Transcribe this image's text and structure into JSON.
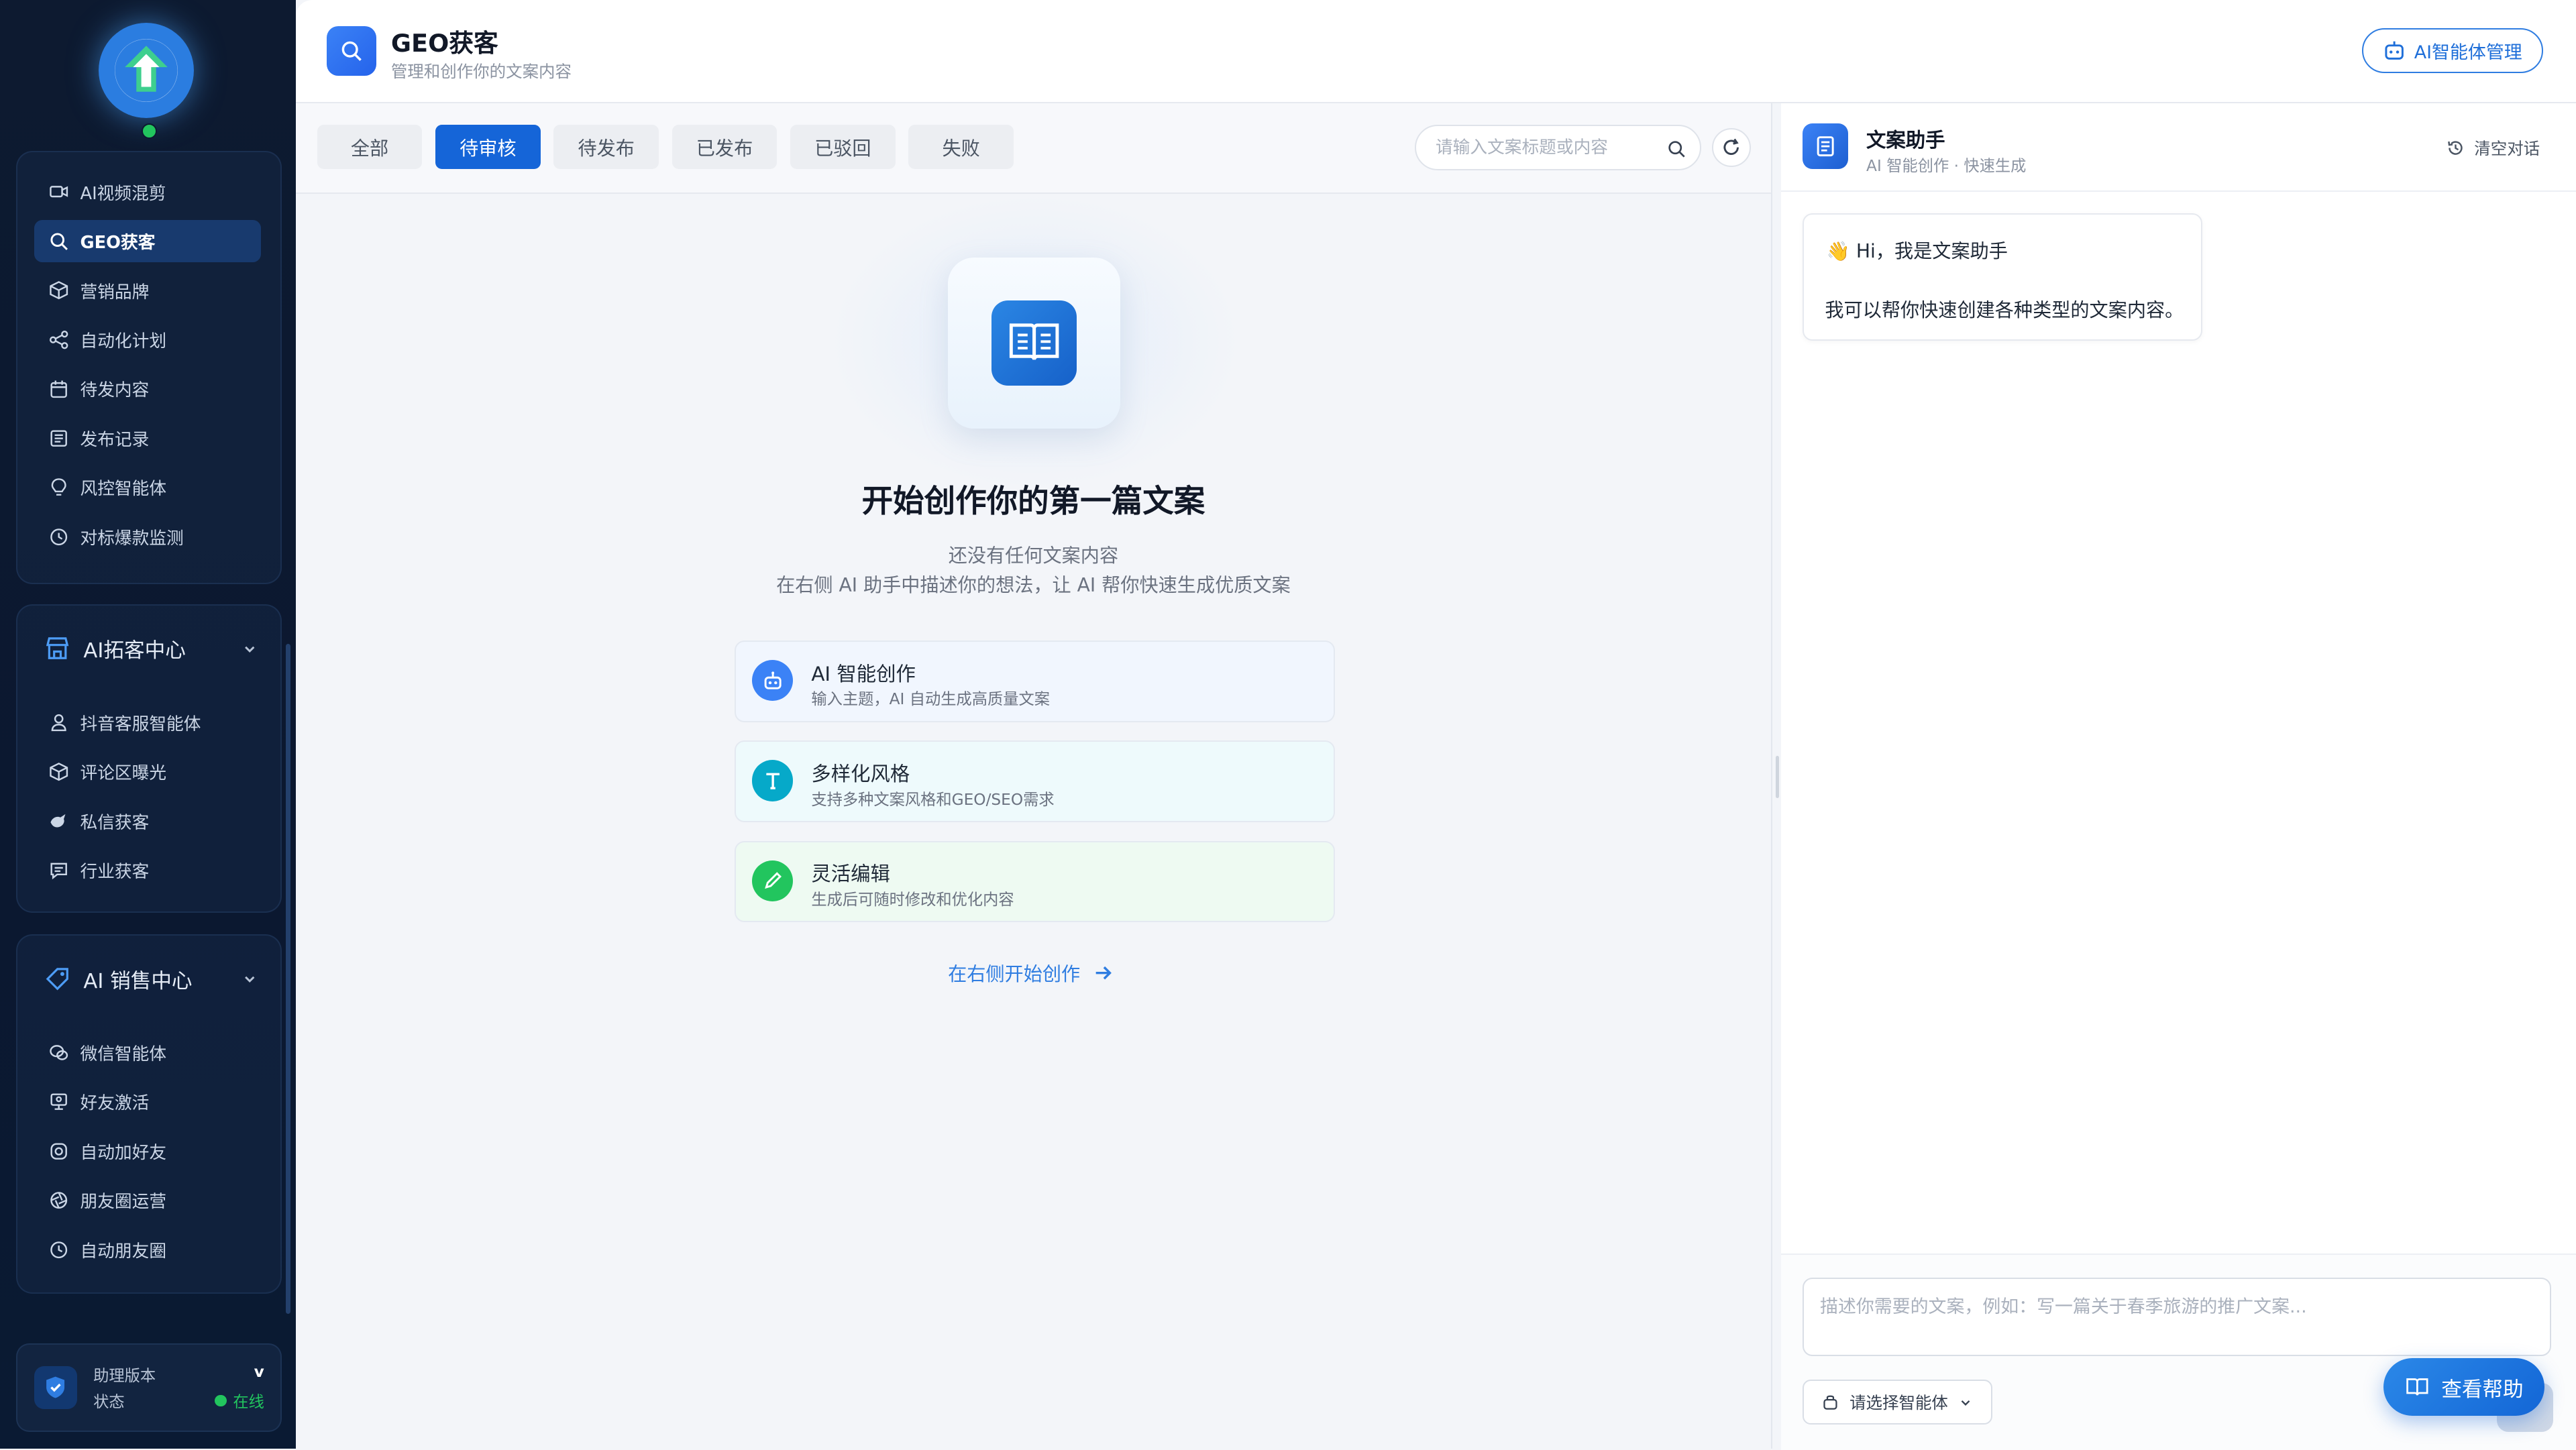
{
  "sidebar": {
    "top_items": [
      {
        "label": "AI视频混剪",
        "icon": "video-icon"
      },
      {
        "label": "GEO获客",
        "icon": "search-icon",
        "active": true
      },
      {
        "label": "营销品牌",
        "icon": "box-icon"
      },
      {
        "label": "自动化计划",
        "icon": "share-nodes-icon"
      },
      {
        "label": "待发内容",
        "icon": "calendar-icon"
      },
      {
        "label": "发布记录",
        "icon": "list-icon"
      },
      {
        "label": "风控智能体",
        "icon": "bulb-icon"
      },
      {
        "label": "对标爆款监测",
        "icon": "history-icon"
      }
    ],
    "group2": {
      "title": "AI拓客中心",
      "items": [
        {
          "label": "抖音客服智能体",
          "icon": "person-headset-icon"
        },
        {
          "label": "评论区曝光",
          "icon": "cube-icon"
        },
        {
          "label": "私信获客",
          "icon": "bird-icon"
        },
        {
          "label": "行业获客",
          "icon": "message-icon"
        }
      ]
    },
    "group3": {
      "title": "AI 销售中心",
      "items": [
        {
          "label": "微信智能体",
          "icon": "wechat-icon"
        },
        {
          "label": "好友激活",
          "icon": "user-screen-icon"
        },
        {
          "label": "自动加好友",
          "icon": "circle-icon"
        },
        {
          "label": "朋友圈运营",
          "icon": "aperture-icon"
        },
        {
          "label": "自动朋友圈",
          "icon": "clock-icon"
        }
      ]
    },
    "status": {
      "label_version": "助理版本",
      "version": "v",
      "label_status": "状态",
      "status": "在线"
    }
  },
  "header": {
    "title": "GEO获客",
    "subtitle": "管理和创作你的文案内容",
    "agent_button": "AI智能体管理"
  },
  "tabs": [
    {
      "label": "全部"
    },
    {
      "label": "待审核",
      "active": true
    },
    {
      "label": "待发布"
    },
    {
      "label": "已发布"
    },
    {
      "label": "已驳回"
    },
    {
      "label": "失败"
    }
  ],
  "search": {
    "placeholder": "请输入文案标题或内容"
  },
  "empty": {
    "title": "开始创作你的第一篇文案",
    "line1": "还没有任何文案内容",
    "line2": "在右侧 AI 助手中描述你的想法，让 AI 帮你快速生成优质文案",
    "features": [
      {
        "title": "AI 智能创作",
        "desc": "输入主题，AI 自动生成高质量文案",
        "icon": "robot-icon",
        "color": "#3b82f6",
        "bg": "#f1f6fe"
      },
      {
        "title": "多样化风格",
        "desc": "支持多种文案风格和GEO/SEO需求",
        "icon": "text-t-icon",
        "color": "#06a9c9",
        "bg": "#eefafc"
      },
      {
        "title": "灵活编辑",
        "desc": "生成后可随时修改和优化内容",
        "icon": "pencil-icon",
        "color": "#22c55e",
        "bg": "#eefaf2"
      }
    ],
    "start_link": "在右侧开始创作"
  },
  "assistant": {
    "title": "文案助手",
    "subtitle": "AI 智能创作 · 快速生成",
    "clear": "清空对话",
    "greeting_emoji": "👋",
    "greeting": "Hi，我是文案助手",
    "message": "我可以帮你快速创建各种类型的文案内容。",
    "input_placeholder": "描述你需要的文案，例如：写一篇关于春季旅游的推广文案...",
    "select_agent": "请选择智能体",
    "help_button": "查看帮助"
  }
}
